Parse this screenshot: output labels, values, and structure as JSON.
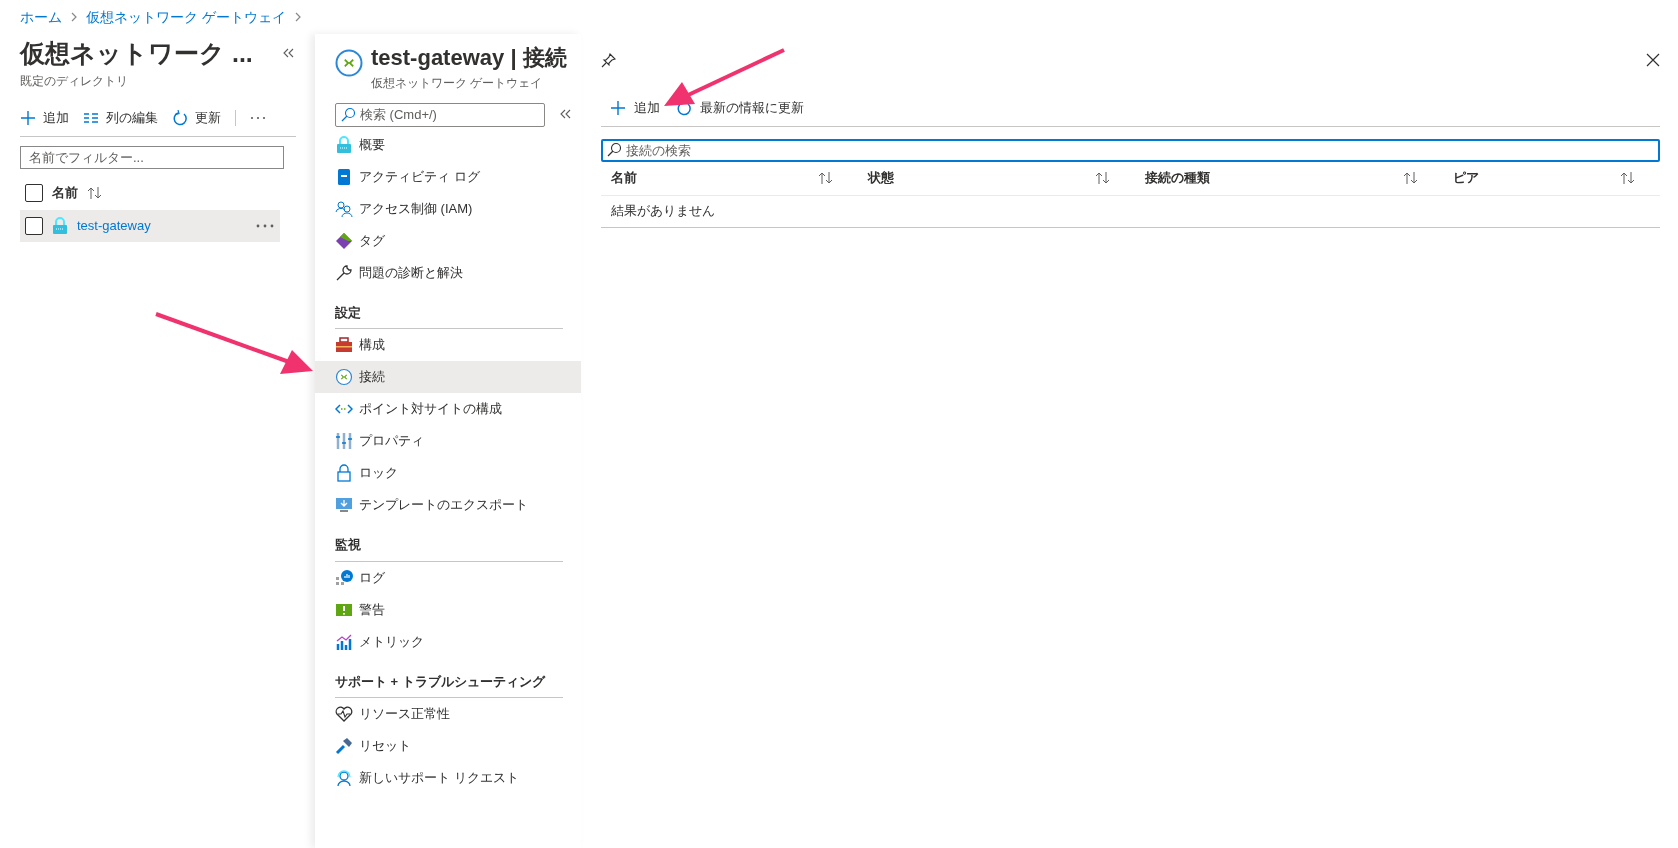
{
  "breadcrumb": [
    "ホーム",
    "仮想ネットワーク ゲートウェイ"
  ],
  "list_pane": {
    "title": "仮想ネットワーク ...",
    "subtitle": "既定のディレクトリ",
    "toolbar": [
      "追加",
      "列の編集",
      "更新"
    ],
    "filter": {
      "placeholder": "名前でフィルター..."
    },
    "header": {
      "label": "名前",
      "checked": false
    },
    "rows": [
      {
        "name": "test-gateway",
        "checked": false,
        "selected": true
      }
    ]
  },
  "resource": {
    "title": "test-gateway | 接続",
    "subtitle": "仮想ネットワーク ゲートウェイ",
    "search": {
      "placeholder": "検索 (Cmd+/)"
    },
    "menu": [
      {
        "kind": "item",
        "label": "概要",
        "selected": false
      },
      {
        "kind": "item",
        "label": "アクティビティ ログ",
        "selected": false
      },
      {
        "kind": "item",
        "label": "アクセス制御 (IAM)",
        "selected": false
      },
      {
        "kind": "item",
        "label": "タグ",
        "selected": false
      },
      {
        "kind": "item",
        "label": "問題の診断と解決",
        "selected": false
      },
      {
        "kind": "section",
        "label": "設定"
      },
      {
        "kind": "item",
        "label": "構成",
        "selected": false
      },
      {
        "kind": "item",
        "label": "接続",
        "selected": true
      },
      {
        "kind": "item",
        "label": "ポイント対サイトの構成",
        "selected": false
      },
      {
        "kind": "item",
        "label": "プロパティ",
        "selected": false
      },
      {
        "kind": "item",
        "label": "ロック",
        "selected": false
      },
      {
        "kind": "item",
        "label": "テンプレートのエクスポート",
        "selected": false
      },
      {
        "kind": "section",
        "label": "監視"
      },
      {
        "kind": "item",
        "label": "ログ",
        "selected": false
      },
      {
        "kind": "item",
        "label": "警告",
        "selected": false
      },
      {
        "kind": "item",
        "label": "メトリック",
        "selected": false
      },
      {
        "kind": "section",
        "label": "サポート + トラブルシューティング"
      },
      {
        "kind": "item",
        "label": "リソース正常性",
        "selected": false
      },
      {
        "kind": "item",
        "label": "リセット",
        "selected": false
      },
      {
        "kind": "item",
        "label": "新しいサポート リクエスト",
        "selected": false
      }
    ]
  },
  "content": {
    "toolbar": [
      "追加",
      "最新の情報に更新"
    ],
    "search": {
      "placeholder": "接続の検索"
    },
    "table": {
      "columns": [
        "名前",
        "状態",
        "接続の種類",
        "ピア"
      ],
      "empty_message": "結果がありません"
    }
  }
}
